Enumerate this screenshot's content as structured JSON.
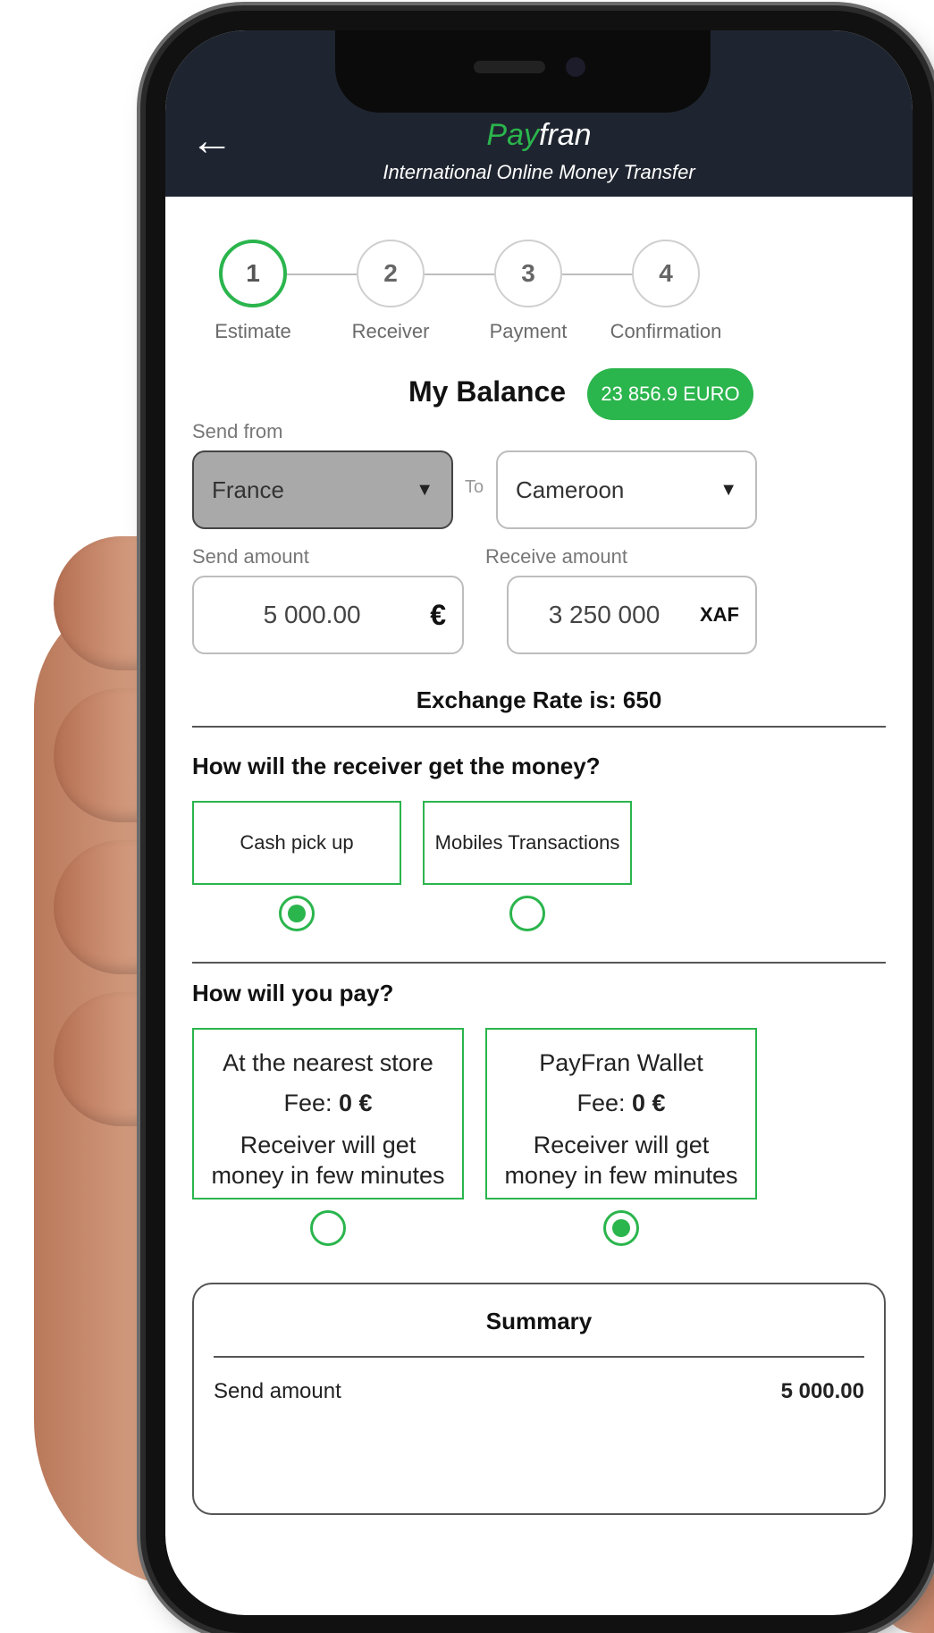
{
  "app": {
    "brand_pay": "Pay",
    "brand_fran": "fran",
    "tagline": "International Online Money Transfer"
  },
  "steps": [
    {
      "number": "1",
      "label": "Estimate",
      "active": true
    },
    {
      "number": "2",
      "label": "Receiver",
      "active": false
    },
    {
      "number": "3",
      "label": "Payment",
      "active": false
    },
    {
      "number": "4",
      "label": "Confirmation",
      "active": false
    }
  ],
  "balance": {
    "title": "My Balance",
    "amount": "23 856.9 EURO"
  },
  "route": {
    "send_from_label": "Send from",
    "from_country": "France",
    "to_label": "To",
    "to_country": "Cameroon"
  },
  "amounts": {
    "send_label": "Send amount",
    "send_value": "5 000.00",
    "send_currency": "€",
    "receive_label": "Receive amount",
    "receive_value": "3 250 000",
    "receive_currency": "XAF",
    "exchange_rate": "Exchange Rate is: 650"
  },
  "receive_method": {
    "question": "How will the receiver get the money?",
    "options": [
      {
        "label": "Cash pick up",
        "selected": true
      },
      {
        "label": "Mobiles Transactions",
        "selected": false
      }
    ]
  },
  "pay_method": {
    "question": "How will you pay?",
    "options": [
      {
        "title": "At the nearest store",
        "fee_label": "Fee:",
        "fee_value": "0 €",
        "desc_line1": "Receiver will get",
        "desc_line2": "money in few minutes",
        "selected": false
      },
      {
        "title": "PayFran Wallet",
        "fee_label": "Fee:",
        "fee_value": "0 €",
        "desc_line1": "Receiver will get",
        "desc_line2": "money in few minutes",
        "selected": true
      }
    ]
  },
  "summary": {
    "title": "Summary",
    "send_amount_label": "Send amount",
    "send_amount_value": "5 000.00"
  },
  "colors": {
    "accent": "#2bb54d",
    "appbar": "#1f2530"
  }
}
